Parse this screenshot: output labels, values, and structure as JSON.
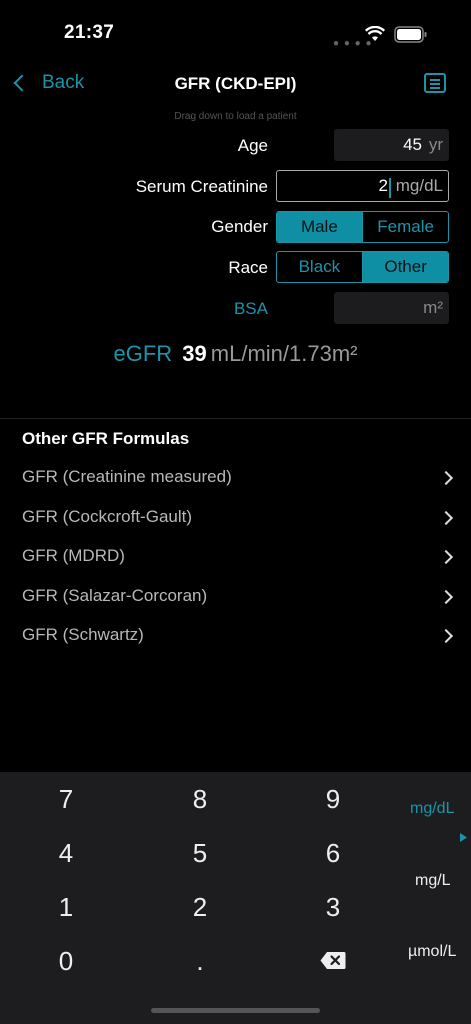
{
  "status": {
    "time": "21:37"
  },
  "nav": {
    "back_label": "Back",
    "title": "GFR (CKD-EPI)",
    "hint": "Drag down to load a patient"
  },
  "form": {
    "age": {
      "label": "Age",
      "value": "45",
      "unit": "yr"
    },
    "creatinine": {
      "label": "Serum Creatinine",
      "value": "2",
      "unit": "mg/dL"
    },
    "gender": {
      "label": "Gender",
      "options": [
        "Male",
        "Female"
      ],
      "selected": "Male"
    },
    "race": {
      "label": "Race",
      "options": [
        "Black",
        "Other"
      ],
      "selected": "Other"
    },
    "bsa": {
      "label": "BSA",
      "value": "",
      "unit": "m²"
    }
  },
  "result": {
    "label": "eGFR",
    "value": "39",
    "unit": "mL/min/1.73m²"
  },
  "other": {
    "title": "Other GFR Formulas",
    "items": [
      "GFR (Creatinine measured)",
      "GFR (Cockcroft-Gault)",
      "GFR (MDRD)",
      "GFR (Salazar-Corcoran)",
      "GFR (Schwartz)"
    ]
  },
  "keypad": {
    "keys": [
      "7",
      "8",
      "9",
      "4",
      "5",
      "6",
      "1",
      "2",
      "3",
      "0",
      "."
    ],
    "units": [
      "mg/dL",
      "mg/L",
      "µmol/L"
    ],
    "selected_unit": "mg/dL"
  },
  "colors": {
    "accent": "#1a94a8",
    "background": "#000000",
    "keypad": "#1d1d1f"
  }
}
